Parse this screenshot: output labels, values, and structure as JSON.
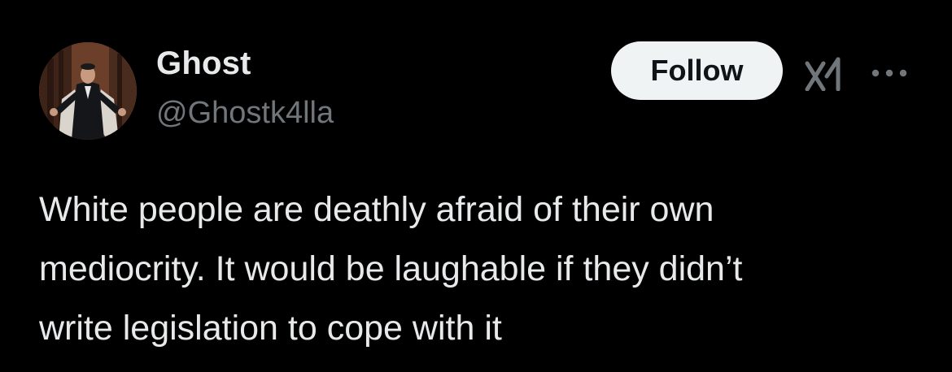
{
  "tweet": {
    "author": {
      "display_name": "Ghost",
      "handle": "@Ghostk4lla"
    },
    "follow_label": "Follow",
    "text": "White people are deathly afraid of their own\nmediocrity. It would be laughable if they didn’t\nwrite legislation to cope with it"
  },
  "icons": {
    "grok": "grok-icon",
    "more": "more-dots-icon"
  },
  "colors": {
    "background": "#000000",
    "primary_text": "#e7e9ea",
    "secondary_text": "#71767b",
    "follow_button_bg": "#eff3f4",
    "follow_button_text": "#0f1419"
  }
}
